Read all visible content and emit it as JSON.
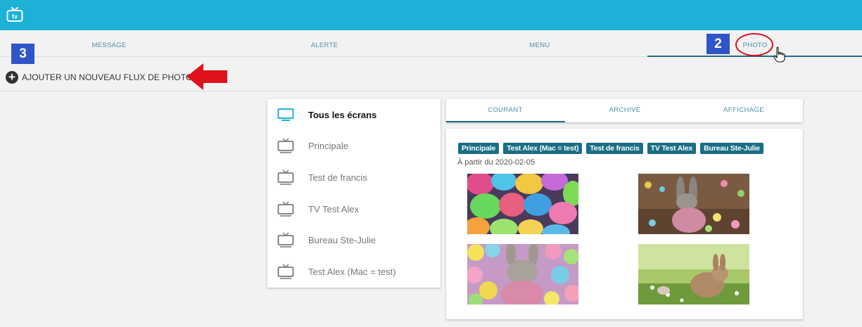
{
  "app": {
    "logo_text": "tv",
    "logo_icon": "tv-logo-icon"
  },
  "nav": {
    "tabs": [
      {
        "label": "MESSAGE"
      },
      {
        "label": "ALERTE"
      },
      {
        "label": "MENU"
      },
      {
        "label": "PHOTO",
        "active": true
      }
    ]
  },
  "annotations": {
    "step2": "2",
    "step3": "3",
    "highlight_color": "#e0101c"
  },
  "actions": {
    "add_photo_feed": "AJOUTER UN NOUVEAU FLUX DE PHOTOS"
  },
  "screens": {
    "items": [
      {
        "label": "Tous les écrans",
        "active": true
      },
      {
        "label": "Principale"
      },
      {
        "label": "Test de francis"
      },
      {
        "label": "TV Test Alex"
      },
      {
        "label": "Bureau Ste-Julie"
      },
      {
        "label": "Test Alex (Mac = test)"
      }
    ]
  },
  "subtabs": {
    "items": [
      {
        "label": "COURANT",
        "active": true
      },
      {
        "label": "ARCHIVE"
      },
      {
        "label": "AFFICHAGE"
      }
    ]
  },
  "feed": {
    "tags": [
      "Principale",
      "Test Alex (Mac = test)",
      "Test de francis",
      "TV Test Alex",
      "Bureau Ste-Julie"
    ],
    "date": "À partir du 2020-02-05",
    "photos": [
      "easter-eggs-photo",
      "bunny-plush-photo",
      "bunny-pompoms-photo",
      "bunny-grass-photo"
    ]
  },
  "colors": {
    "topbar": "#1eb1d7",
    "accent": "#1f6a8a",
    "chip": "#1a6e86",
    "badge": "#2f55c9"
  }
}
